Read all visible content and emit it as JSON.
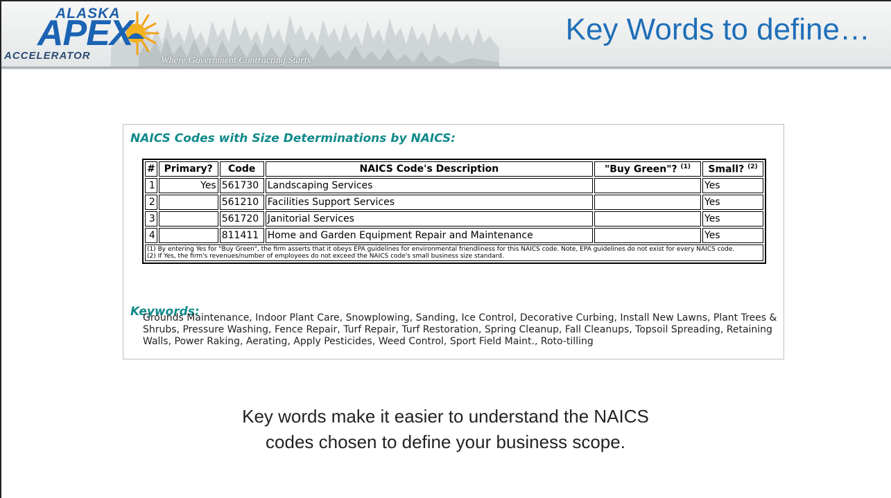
{
  "header": {
    "logo_top": "ALASKA",
    "logo_main": "APEX",
    "logo_bottom": "ACCELERATOR",
    "tagline": "Where Government Contracting Starts",
    "title": "Key Words to define…"
  },
  "card": {
    "heading": "NAICS Codes with Size Determinations by NAICS:",
    "table": {
      "headers": [
        "#",
        "Primary?",
        "Code",
        "NAICS Code's Description",
        "\"Buy Green\"?",
        "Small?"
      ],
      "header_sups": [
        "(1)",
        "(2)"
      ],
      "rows": [
        {
          "n": "1",
          "primary": "Yes",
          "code": "561730",
          "desc": "Landscaping Services",
          "green": "",
          "small": "Yes"
        },
        {
          "n": "2",
          "primary": "",
          "code": "561210",
          "desc": "Facilities Support Services",
          "green": "",
          "small": "Yes"
        },
        {
          "n": "3",
          "primary": "",
          "code": "561720",
          "desc": "Janitorial Services",
          "green": "",
          "small": "Yes"
        },
        {
          "n": "4",
          "primary": "",
          "code": "811411",
          "desc": "Home and Garden Equipment Repair and Maintenance",
          "green": "",
          "small": "Yes"
        }
      ],
      "footnote1": "(1) By entering Yes for \"Buy Green\", the firm asserts that it obeys EPA guidelines for environmental friendliness for this NAICS code. Note, EPA guidelines do not exist for every NAICS code.",
      "footnote2": "(2) If Yes, the firm's revenues/number of employees do not exceed the NAICS code's small business size standard."
    },
    "keywords_heading": "Keywords:",
    "keywords_text": "Grounds Maintenance, Indoor Plant Care, Snowplowing, Sanding, Ice Control, Decorative Curbing, Install New Lawns, Plant Trees & Shrubs, Pressure Washing, Fence Repair, Turf Repair, Turf Restoration, Spring Cleanup, Fall Cleanups, Topsoil Spreading, Retaining Walls, Power Raking, Aerating, Apply Pesticides, Weed Control, Sport Field Maint., Roto-tilling"
  },
  "caption": {
    "line1": "Key words make it easier to understand the NAICS",
    "line2": "codes chosen to define your business scope."
  },
  "colors": {
    "title": "#1f6fb8",
    "heading": "#118a8a",
    "logo": "#1b63b3"
  }
}
